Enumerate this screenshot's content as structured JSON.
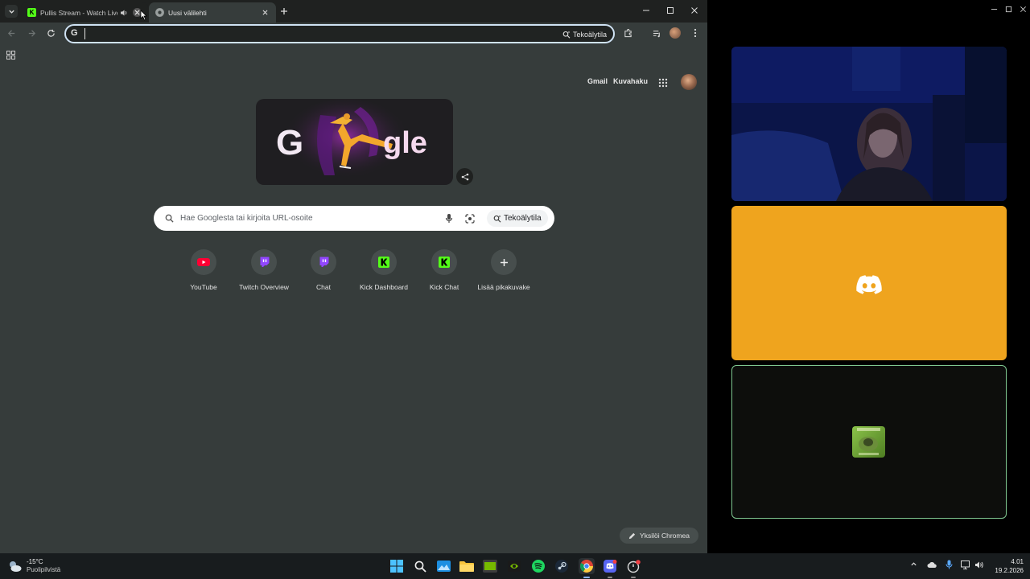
{
  "tabs": [
    {
      "title": "Pullis Stream - Watch Live o",
      "active": false
    },
    {
      "title": "Uusi välilehti",
      "active": true
    }
  ],
  "omnibox": {
    "value": "",
    "ai_mode_label": "Tekoälytila"
  },
  "ntp": {
    "gmail": "Gmail",
    "images": "Kuvahaku",
    "doodle_letters_left": "G",
    "doodle_letters_right": "gle",
    "search_placeholder": "Hae Googlesta tai kirjoita URL-osoite",
    "search_ai_label": "Tekoälytila",
    "shortcuts": [
      {
        "label": "YouTube",
        "icon": "youtube-icon"
      },
      {
        "label": "Twitch Overview",
        "icon": "twitch-icon"
      },
      {
        "label": "Chat",
        "icon": "twitch-icon"
      },
      {
        "label": "Kick Dashboard",
        "icon": "kick-icon"
      },
      {
        "label": "Kick Chat",
        "icon": "kick-icon"
      },
      {
        "label": "Lisää pikakuvake",
        "icon": "plus-icon"
      }
    ],
    "customize_label": "Yksilöi Chromea"
  },
  "weather": {
    "temp": "-15°C",
    "desc": "Puolipilvistä"
  },
  "clock": {
    "time": "4.01",
    "date": "19.2.2026"
  },
  "colors": {
    "discord_tile": "#efa41e",
    "kick_green": "#53fc18",
    "twitch_purple": "#9146ff",
    "youtube_red": "#ff0033"
  }
}
